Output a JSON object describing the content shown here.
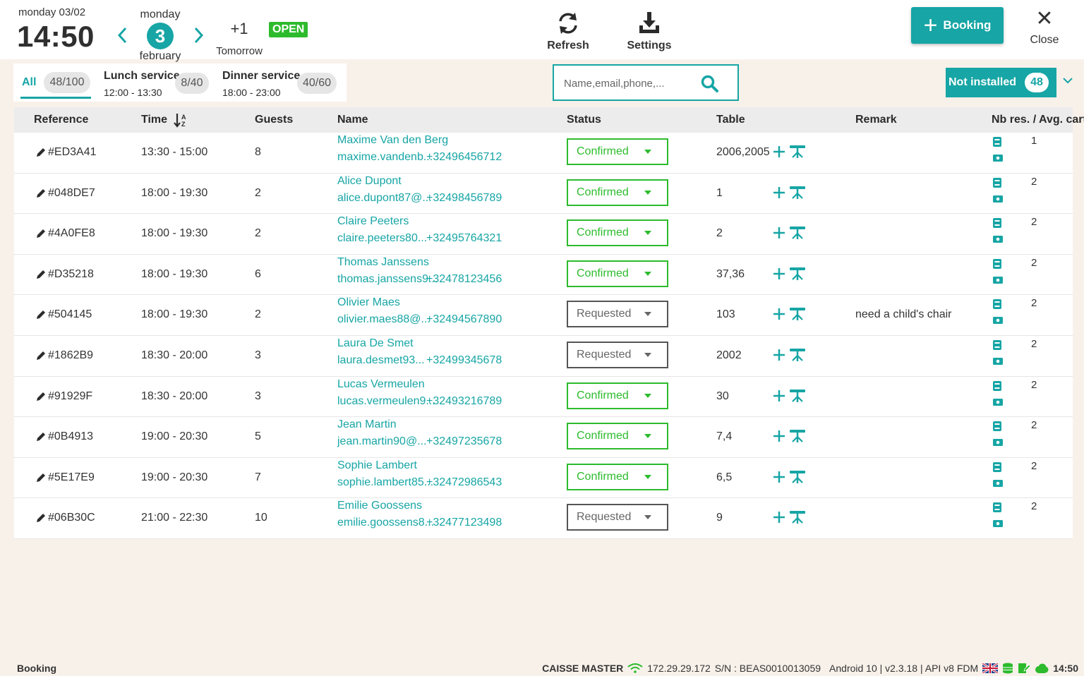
{
  "header": {
    "date_short": "monday 03/02",
    "clock": "14:50",
    "day_name": "monday",
    "day_number": "3",
    "month_name": "february",
    "tomorrow_offset": "+1",
    "tomorrow_label": "Tomorrow",
    "open_badge": "OPEN",
    "refresh_label": "Refresh",
    "settings_label": "Settings",
    "booking_label": "Booking",
    "close_label": "Close",
    "accent_color": "#17a5a5",
    "confirmed_color": "#2dbb2d"
  },
  "services": {
    "all_label": "All",
    "all_count": "48/100",
    "lunch": {
      "title": "Lunch service",
      "hours": "12:00 - 13:30",
      "count": "8/40"
    },
    "dinner": {
      "title": "Dinner service",
      "hours": "18:00 - 23:00",
      "count": "40/60"
    }
  },
  "search": {
    "placeholder": "Name,email,phone,..."
  },
  "not_installed": {
    "label": "Not installed",
    "count": "48"
  },
  "columns": {
    "reference": "Reference",
    "time": "Time",
    "guests": "Guests",
    "name": "Name",
    "status": "Status",
    "table": "Table",
    "remark": "Remark",
    "nb": "Nb res. / Avg. cart"
  },
  "reservations": [
    {
      "ref": "#ED3A41",
      "time": "13:30 - 15:00",
      "guests": "8",
      "name": "Maxime Van den Berg",
      "email": "maxime.vandenb...",
      "phone": "+32496456712",
      "status": "Confirmed",
      "table": "2006,2005",
      "remark": "",
      "nb": "1"
    },
    {
      "ref": "#048DE7",
      "time": "18:00 - 19:30",
      "guests": "2",
      "name": "Alice Dupont",
      "email": "alice.dupont87@...",
      "phone": "+32498456789",
      "status": "Confirmed",
      "table": "1",
      "remark": "",
      "nb": "2"
    },
    {
      "ref": "#4A0FE8",
      "time": "18:00 - 19:30",
      "guests": "2",
      "name": "Claire Peeters",
      "email": "claire.peeters80...",
      "phone": "+32495764321",
      "status": "Confirmed",
      "table": "2",
      "remark": "",
      "nb": "2"
    },
    {
      "ref": "#D35218",
      "time": "18:00 - 19:30",
      "guests": "6",
      "name": "Thomas Janssens",
      "email": "thomas.janssens9...",
      "phone": "+32478123456",
      "status": "Confirmed",
      "table": "37,36",
      "remark": "",
      "nb": "2"
    },
    {
      "ref": "#504145",
      "time": "18:00 - 19:30",
      "guests": "2",
      "name": "Olivier Maes",
      "email": "olivier.maes88@...",
      "phone": "+32494567890",
      "status": "Requested",
      "table": "103",
      "remark": "need a child's chair",
      "nb": "2"
    },
    {
      "ref": "#1862B9",
      "time": "18:30 - 20:00",
      "guests": "3",
      "name": "Laura De Smet",
      "email": "laura.desmet93...",
      "phone": "+32499345678",
      "status": "Requested",
      "table": "2002",
      "remark": "",
      "nb": "2"
    },
    {
      "ref": "#91929F",
      "time": "18:30 - 20:00",
      "guests": "3",
      "name": "Lucas Vermeulen",
      "email": "lucas.vermeulen9...",
      "phone": "+32493216789",
      "status": "Confirmed",
      "table": "30",
      "remark": "",
      "nb": "2"
    },
    {
      "ref": "#0B4913",
      "time": "19:00 - 20:30",
      "guests": "5",
      "name": "Jean Martin",
      "email": "jean.martin90@...",
      "phone": "+32497235678",
      "status": "Confirmed",
      "table": "7,4",
      "remark": "",
      "nb": "2"
    },
    {
      "ref": "#5E17E9",
      "time": "19:00 - 20:30",
      "guests": "7",
      "name": "Sophie Lambert",
      "email": "sophie.lambert85...",
      "phone": "+32472986543",
      "status": "Confirmed",
      "table": "6,5",
      "remark": "",
      "nb": "2"
    },
    {
      "ref": "#06B30C",
      "time": "21:00 - 22:30",
      "guests": "10",
      "name": "Emilie Goossens",
      "email": "emilie.goossens8...",
      "phone": "+32477123498",
      "status": "Requested",
      "table": "9",
      "remark": "",
      "nb": "2"
    }
  ],
  "footer": {
    "left": "Booking",
    "pos_name": "CAISSE MASTER",
    "ip": "172.29.29.172",
    "serial": "S/N : BEAS0010013059",
    "version": "Android 10 | v2.3.18 | API v8 FDM",
    "clock": "14:50"
  }
}
